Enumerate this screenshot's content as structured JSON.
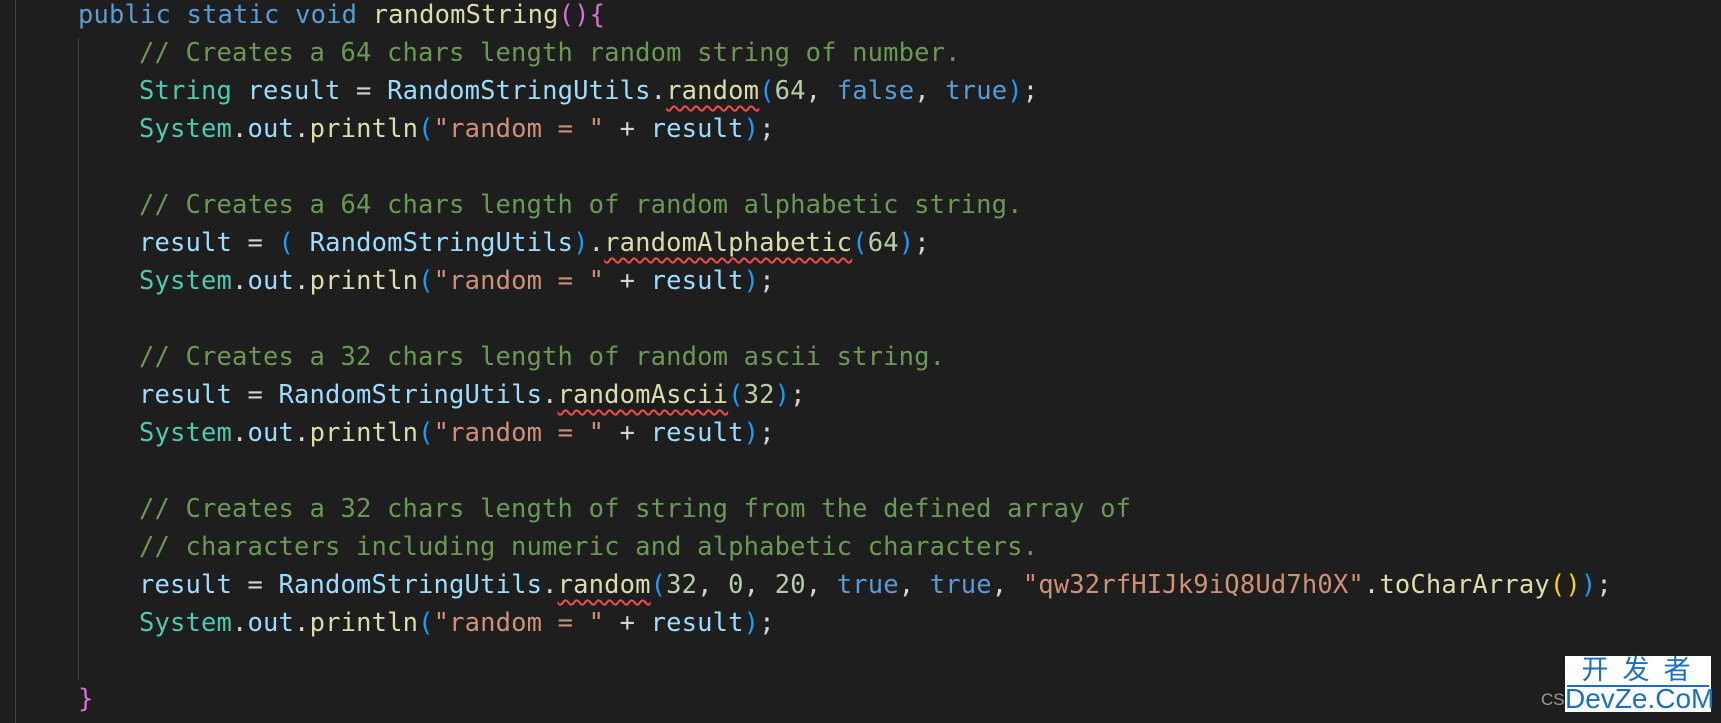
{
  "editor": {
    "language": "java",
    "theme_colors": {
      "background": "#1e1e1e",
      "keyword": "#569cd6",
      "type": "#4ec9b0",
      "function": "#dcdcaa",
      "variable": "#9cdcfe",
      "comment": "#6a9955",
      "number": "#b5cea8",
      "string": "#ce9178",
      "error_squiggle": "#f14c4c"
    },
    "lines": [
      {
        "tokens": [
          [
            "kw",
            "public"
          ],
          [
            "op",
            " "
          ],
          [
            "kw",
            "static"
          ],
          [
            "op",
            " "
          ],
          [
            "kw",
            "void"
          ],
          [
            "op",
            " "
          ],
          [
            "fn",
            "randomString"
          ],
          [
            "p1",
            "()"
          ],
          [
            "p1",
            "{"
          ]
        ]
      },
      {
        "tokens": [
          [
            "cm",
            "// Creates a 64 chars length random string of number."
          ]
        ]
      },
      {
        "tokens": [
          [
            "ty",
            "String"
          ],
          [
            "op",
            " "
          ],
          [
            "var",
            "result"
          ],
          [
            "op",
            " = "
          ],
          [
            "var",
            "RandomStringUtils"
          ],
          [
            "op",
            "."
          ],
          [
            "fn squig",
            "random"
          ],
          [
            "p2",
            "("
          ],
          [
            "num",
            "64"
          ],
          [
            "op",
            ", "
          ],
          [
            "kw",
            "false"
          ],
          [
            "op",
            ", "
          ],
          [
            "kw",
            "true"
          ],
          [
            "p2",
            ")"
          ],
          [
            "op",
            ";"
          ]
        ]
      },
      {
        "tokens": [
          [
            "ty",
            "System"
          ],
          [
            "op",
            "."
          ],
          [
            "var",
            "out"
          ],
          [
            "op",
            "."
          ],
          [
            "fn",
            "println"
          ],
          [
            "p2",
            "("
          ],
          [
            "str",
            "\"random = \""
          ],
          [
            "op",
            " + "
          ],
          [
            "var",
            "result"
          ],
          [
            "p2",
            ")"
          ],
          [
            "op",
            ";"
          ]
        ]
      },
      {
        "tokens": []
      },
      {
        "tokens": [
          [
            "cm",
            "// Creates a 64 chars length of random alphabetic string."
          ]
        ]
      },
      {
        "tokens": [
          [
            "var",
            "result"
          ],
          [
            "op",
            " = "
          ],
          [
            "p2",
            "("
          ],
          [
            "op",
            " "
          ],
          [
            "var",
            "RandomStringUtils"
          ],
          [
            "p2",
            ")"
          ],
          [
            "op",
            "."
          ],
          [
            "fn squig",
            "randomAlphabetic"
          ],
          [
            "p2",
            "("
          ],
          [
            "num",
            "64"
          ],
          [
            "p2",
            ")"
          ],
          [
            "op",
            ";"
          ]
        ]
      },
      {
        "tokens": [
          [
            "ty",
            "System"
          ],
          [
            "op",
            "."
          ],
          [
            "var",
            "out"
          ],
          [
            "op",
            "."
          ],
          [
            "fn",
            "println"
          ],
          [
            "p2",
            "("
          ],
          [
            "str",
            "\"random = \""
          ],
          [
            "op",
            " + "
          ],
          [
            "var",
            "result"
          ],
          [
            "p2",
            ")"
          ],
          [
            "op",
            ";"
          ]
        ]
      },
      {
        "tokens": []
      },
      {
        "tokens": [
          [
            "cm",
            "// Creates a 32 chars length of random ascii string."
          ]
        ]
      },
      {
        "tokens": [
          [
            "var",
            "result"
          ],
          [
            "op",
            " = "
          ],
          [
            "var",
            "RandomStringUtils"
          ],
          [
            "op",
            "."
          ],
          [
            "fn squig",
            "randomAscii"
          ],
          [
            "p2",
            "("
          ],
          [
            "num",
            "32"
          ],
          [
            "p2",
            ")"
          ],
          [
            "op",
            ";"
          ]
        ]
      },
      {
        "tokens": [
          [
            "ty",
            "System"
          ],
          [
            "op",
            "."
          ],
          [
            "var",
            "out"
          ],
          [
            "op",
            "."
          ],
          [
            "fn",
            "println"
          ],
          [
            "p2",
            "("
          ],
          [
            "str",
            "\"random = \""
          ],
          [
            "op",
            " + "
          ],
          [
            "var",
            "result"
          ],
          [
            "p2",
            ")"
          ],
          [
            "op",
            ";"
          ]
        ]
      },
      {
        "tokens": []
      },
      {
        "tokens": [
          [
            "cm",
            "// Creates a 32 chars length of string from the defined array of"
          ]
        ]
      },
      {
        "tokens": [
          [
            "cm",
            "// characters including numeric and alphabetic characters."
          ]
        ]
      },
      {
        "tokens": [
          [
            "var",
            "result"
          ],
          [
            "op",
            " = "
          ],
          [
            "var",
            "RandomStringUtils"
          ],
          [
            "op",
            "."
          ],
          [
            "fn squig",
            "random"
          ],
          [
            "p2",
            "("
          ],
          [
            "num",
            "32"
          ],
          [
            "op",
            ", "
          ],
          [
            "num",
            "0"
          ],
          [
            "op",
            ", "
          ],
          [
            "num",
            "20"
          ],
          [
            "op",
            ", "
          ],
          [
            "kw",
            "true"
          ],
          [
            "op",
            ", "
          ],
          [
            "kw",
            "true"
          ],
          [
            "op",
            ", "
          ],
          [
            "str",
            "\"qw32rfHIJk9iQ8Ud7h0X\""
          ],
          [
            "op",
            "."
          ],
          [
            "fn",
            "toCharArray"
          ],
          [
            "p3",
            "()"
          ],
          [
            "p2",
            ")"
          ],
          [
            "op",
            ";"
          ]
        ]
      },
      {
        "tokens": [
          [
            "ty",
            "System"
          ],
          [
            "op",
            "."
          ],
          [
            "var",
            "out"
          ],
          [
            "op",
            "."
          ],
          [
            "fn",
            "println"
          ],
          [
            "p2",
            "("
          ],
          [
            "str",
            "\"random = \""
          ],
          [
            "op",
            " + "
          ],
          [
            "var",
            "result"
          ],
          [
            "p2",
            ")"
          ],
          [
            "op",
            ";"
          ]
        ]
      },
      {
        "tokens": []
      },
      {
        "tokens": [
          [
            "p1",
            "}"
          ]
        ]
      }
    ],
    "indent_levels": [
      1,
      2,
      2,
      2,
      2,
      2,
      2,
      2,
      2,
      2,
      2,
      2,
      2,
      2,
      2,
      2,
      2,
      2,
      1
    ]
  },
  "watermark": {
    "prefix": "CS",
    "top": "开发者",
    "bottom": "DevZe.CoM"
  }
}
